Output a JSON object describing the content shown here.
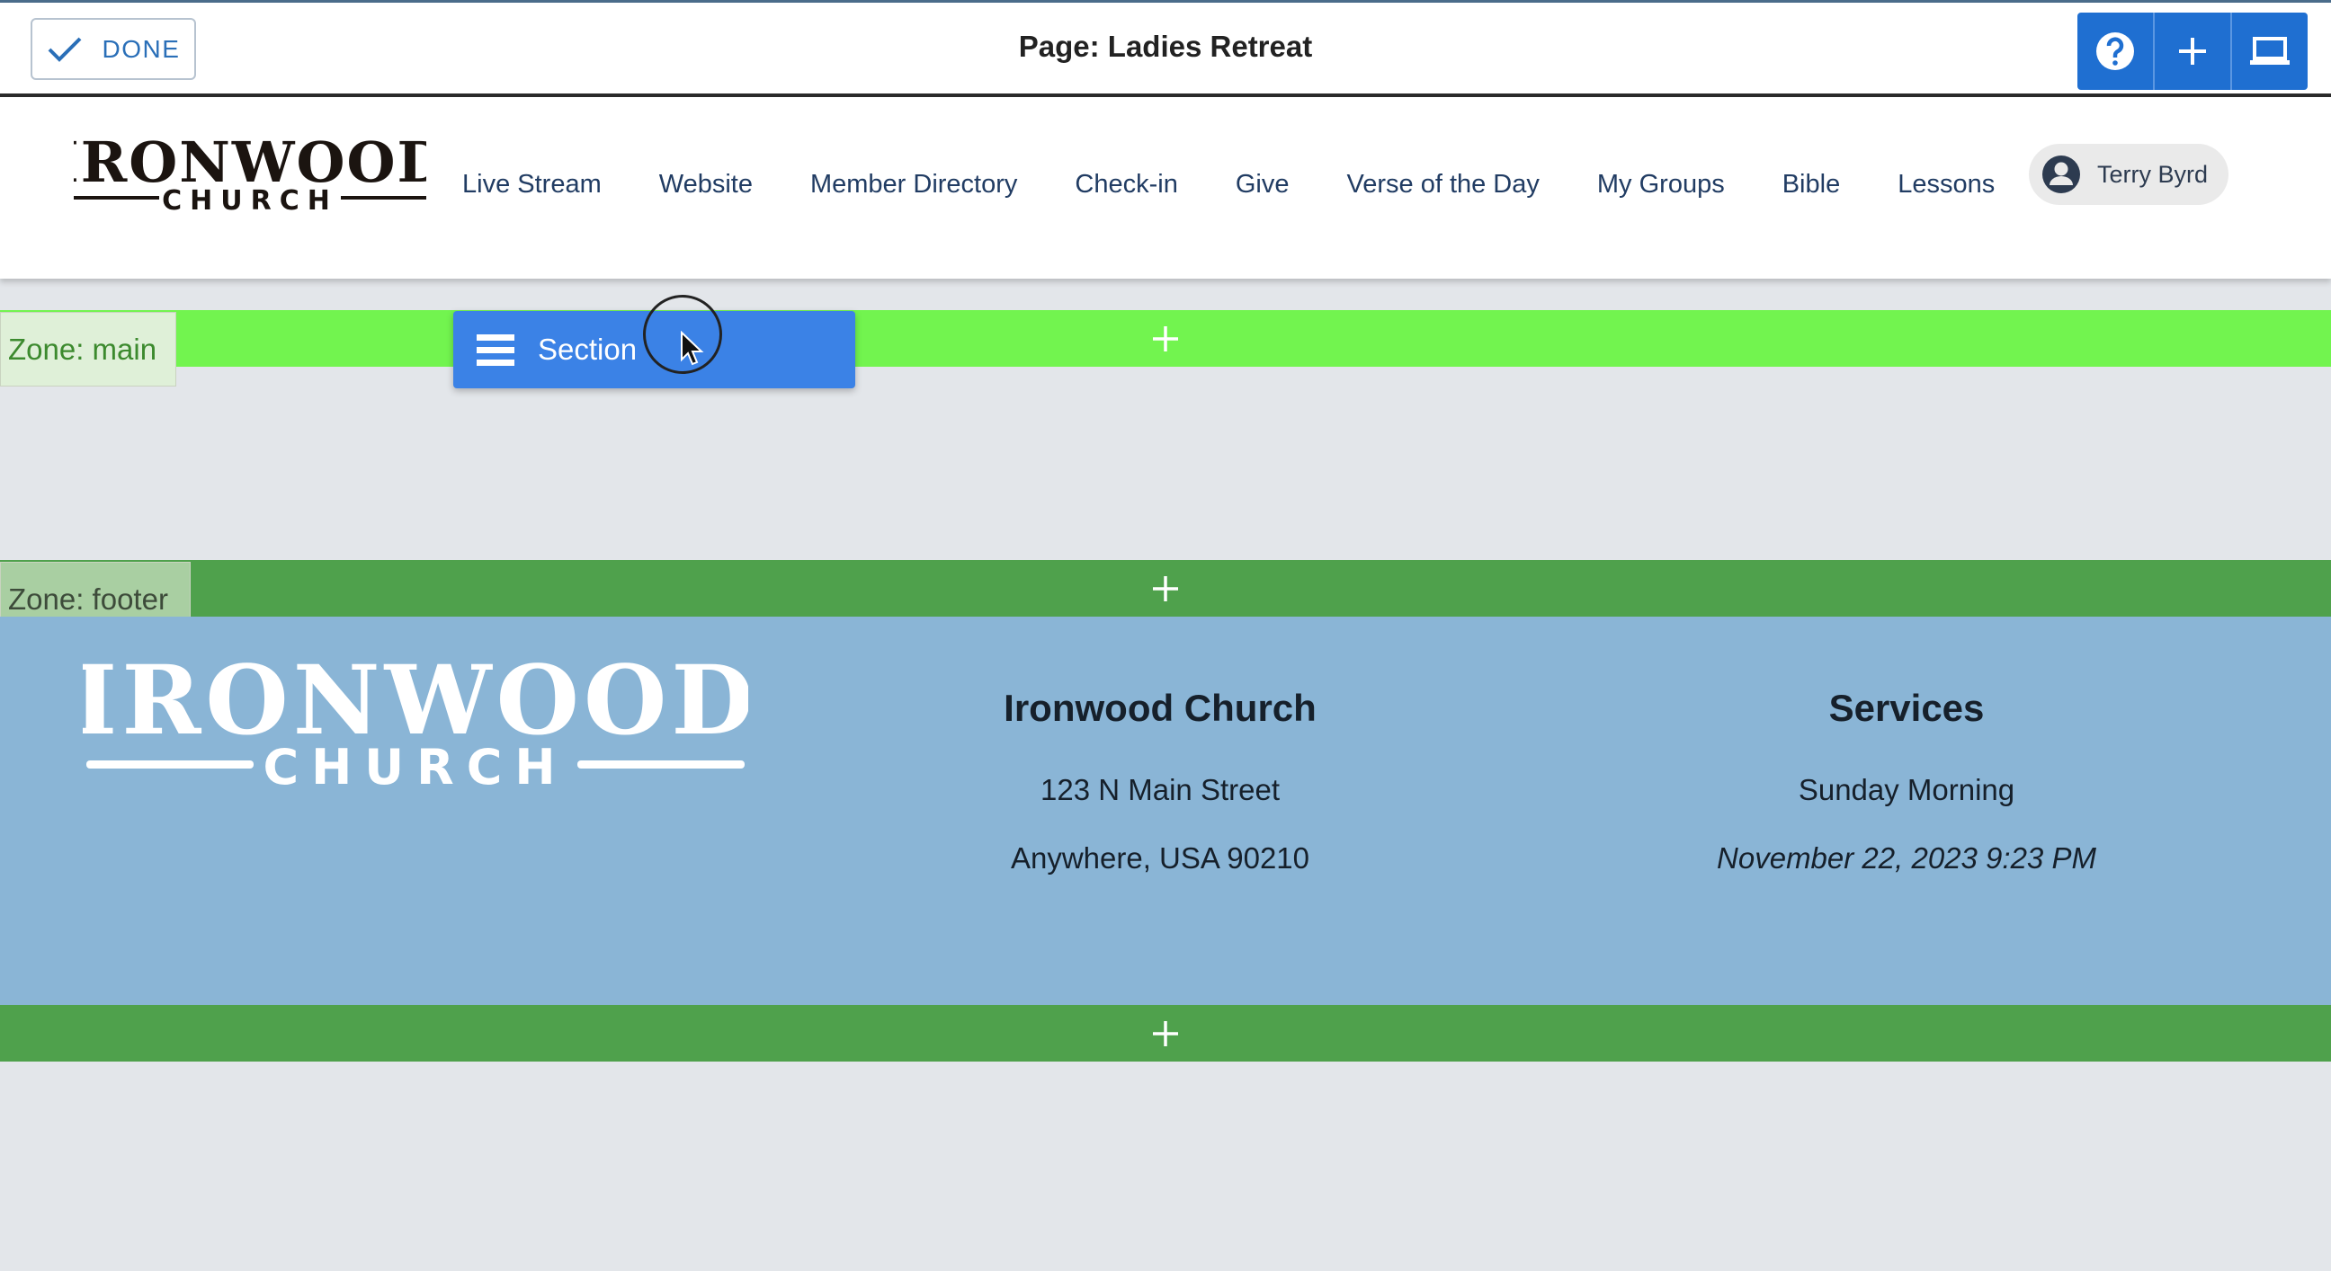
{
  "toolbar": {
    "done_label": "DONE",
    "page_title": "Page: Ladies Retreat",
    "icons": [
      "help-icon",
      "add-icon",
      "device-preview-icon"
    ]
  },
  "header": {
    "logo_top": "IRONWOOD",
    "logo_bottom": "CHURCH",
    "nav": [
      "Live Stream",
      "Website",
      "Member Directory",
      "Check-in",
      "Give",
      "Verse of the Day",
      "My Groups",
      "Bible",
      "Lessons"
    ],
    "user_name": "Terry Byrd"
  },
  "zones": {
    "main_label": "Zone: main",
    "footer_label": "Zone: footer",
    "dragging_item": "Section"
  },
  "footer": {
    "logo_top": "IRONWOOD",
    "logo_bottom": "CHURCH",
    "church": {
      "title": "Ironwood Church",
      "address_line1": "123 N Main Street",
      "address_line2": "Anywhere, USA 90210"
    },
    "services": {
      "title": "Services",
      "service_name": "Sunday Morning",
      "datetime": "November 22, 2023 9:23 PM"
    }
  },
  "colors": {
    "zone_main": "#72f44f",
    "zone_footer": "#4fa14c",
    "footer_bg": "#8ab5d6",
    "accent": "#1f6fd1"
  }
}
